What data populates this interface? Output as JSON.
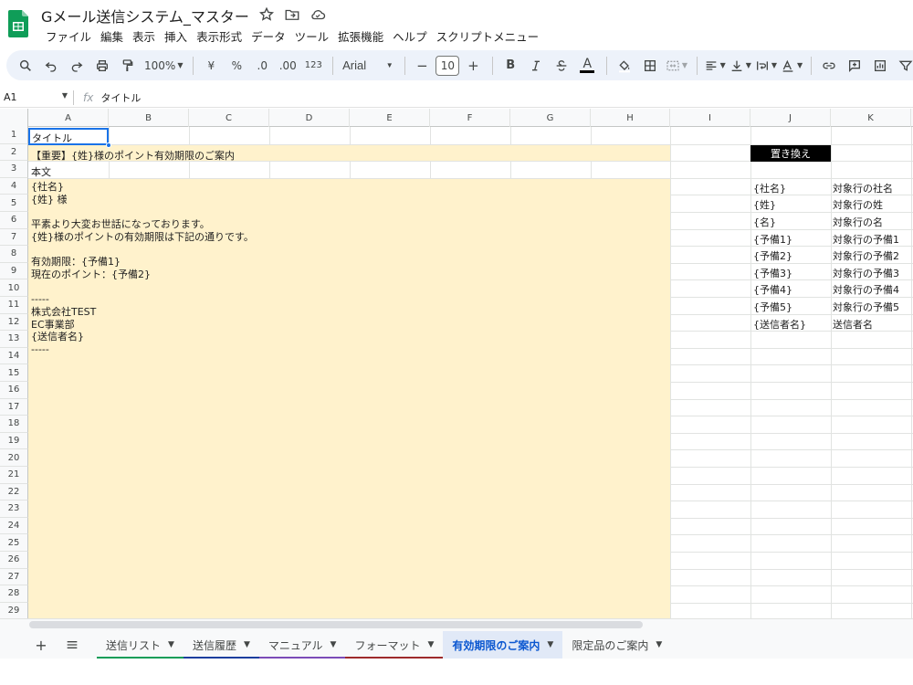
{
  "document": {
    "title": "Gメール送信システム_マスター"
  },
  "menu": [
    "ファイル",
    "編集",
    "表示",
    "挿入",
    "表示形式",
    "データ",
    "ツール",
    "拡張機能",
    "ヘルプ",
    "スクリプトメニュー"
  ],
  "toolbar": {
    "zoom": "100%",
    "currency": "¥",
    "percent": "%",
    "decrease_decimal": ".0",
    "increase_decimal": ".00",
    "number_format": "123",
    "font": "Arial",
    "font_size": "10",
    "minus": "−",
    "plus": "+",
    "bold": "B",
    "text_color": "A"
  },
  "formula_bar": {
    "cell_ref": "A1",
    "content": "タイトル"
  },
  "columns": [
    "A",
    "B",
    "C",
    "D",
    "E",
    "F",
    "G",
    "H",
    "I",
    "J",
    "K"
  ],
  "rows": [
    "1",
    "2",
    "3",
    "4",
    "5",
    "6",
    "7",
    "8",
    "9",
    "10",
    "11",
    "12",
    "13",
    "14",
    "15",
    "16",
    "17",
    "18",
    "19",
    "20",
    "21",
    "22",
    "23",
    "24",
    "25",
    "26",
    "27",
    "28",
    "29"
  ],
  "cells": {
    "a1": "タイトル",
    "a2": "【重要】{姓}様のポイント有効期限のご案内",
    "a3": "本文",
    "body": [
      "{社名}",
      "{姓} 様",
      "",
      "平素より大変お世話になっております。",
      "{姓}様のポイントの有効期限は下記の通りです。",
      "",
      "有効期限：{予備1}",
      "現在のポイント：{予備2}",
      "",
      "-----",
      "株式会社TEST",
      "EC事業部",
      "{送信者名}",
      "-----"
    ]
  },
  "replace_table": {
    "header": "置き換え",
    "rows": [
      {
        "key": "{社名}",
        "value": "対象行の社名"
      },
      {
        "key": "{姓}",
        "value": "対象行の姓"
      },
      {
        "key": "{名}",
        "value": "対象行の名"
      },
      {
        "key": "{予備1}",
        "value": "対象行の予備1"
      },
      {
        "key": "{予備2}",
        "value": "対象行の予備2"
      },
      {
        "key": "{予備3}",
        "value": "対象行の予備3"
      },
      {
        "key": "{予備4}",
        "value": "対象行の予備4"
      },
      {
        "key": "{予備5}",
        "value": "対象行の予備5"
      },
      {
        "key": "{送信者名}",
        "value": "送信者名"
      }
    ]
  },
  "sheet_tabs": [
    {
      "label": "送信リスト",
      "color": "#0f9d58",
      "active": false
    },
    {
      "label": "送信履歴",
      "color": "#1a3e9e",
      "active": false
    },
    {
      "label": "マニュアル",
      "color": "#7b4bb8",
      "active": false
    },
    {
      "label": "フォーマット",
      "color": "#9e2a2b",
      "active": false
    },
    {
      "label": "有効期限のご案内",
      "color": "#e1e9f7",
      "active": true
    },
    {
      "label": "限定品のご案内",
      "color": "",
      "active": false
    }
  ],
  "colors": {
    "accent": "#1a73e8",
    "cell_fill": "#fff2cc",
    "brand": "#0f9d58"
  }
}
